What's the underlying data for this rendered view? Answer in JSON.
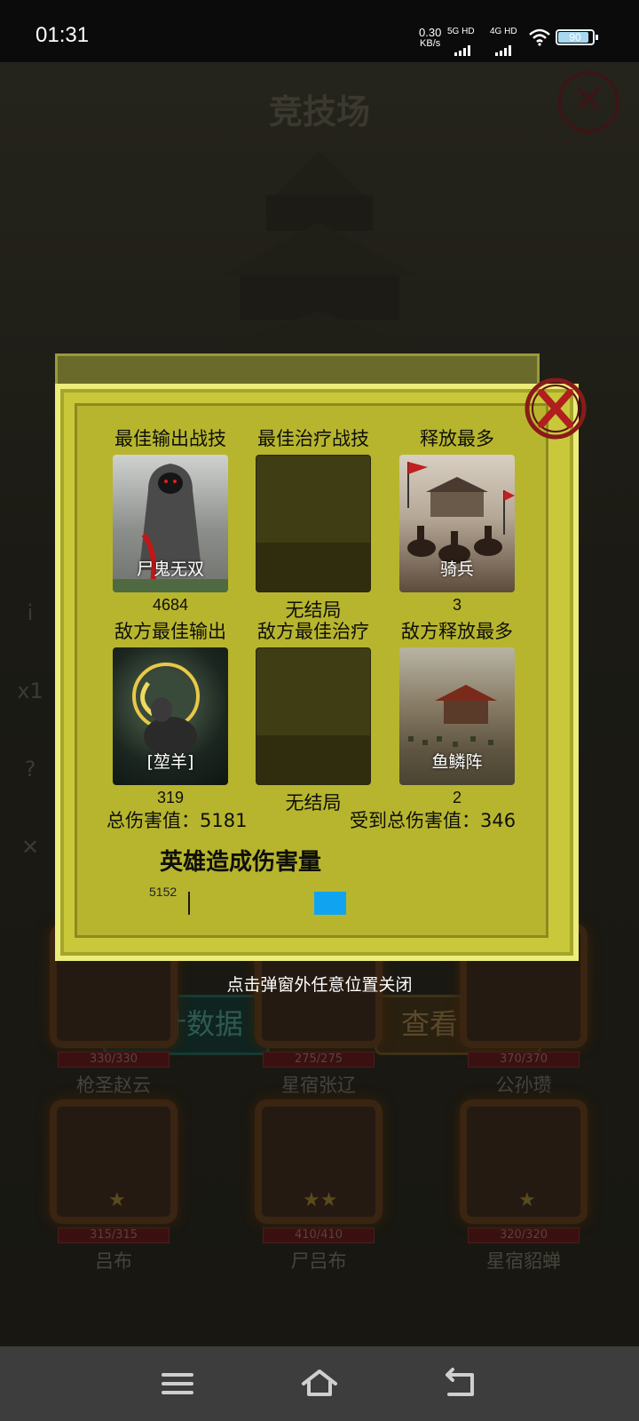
{
  "status": {
    "time": "01:31",
    "net_speed": "0.30",
    "net_unit": "KB/s",
    "sim1": "5G HD",
    "sim2": "4G HD",
    "battery": "90",
    "battery_level": 0.9
  },
  "background": {
    "title": "竞技场",
    "buttons": {
      "stats": "统计数据",
      "report": "查看战报"
    },
    "heroes": [
      {
        "hp": "330/330",
        "name": "枪圣赵云"
      },
      {
        "hp": "275/275",
        "name": "星宿张辽"
      },
      {
        "hp": "370/370",
        "name": "公孙瓒"
      },
      {
        "hp": "315/315",
        "name": "吕布"
      },
      {
        "hp": "410/410",
        "name": "尸吕布"
      },
      {
        "hp": "320/320",
        "name": "星宿貂蝉"
      }
    ],
    "side_icons": [
      "i",
      "x1",
      "?",
      "✕"
    ]
  },
  "popup": {
    "stats": [
      {
        "label": "最佳输出战技",
        "card_name": "尸鬼无双",
        "value": "4684",
        "empty": false
      },
      {
        "label": "最佳治疗战技",
        "card_name": "",
        "value": "无结局",
        "empty": true
      },
      {
        "label": "释放最多",
        "card_name": "骑兵",
        "value": "3",
        "empty": false
      },
      {
        "label": "敌方最佳输出",
        "card_name": "[堃羊]",
        "value": "319",
        "empty": false
      },
      {
        "label": "敌方最佳治疗",
        "card_name": "",
        "value": "无结局",
        "empty": true
      },
      {
        "label": "敌方释放最多",
        "card_name": "鱼鳞阵",
        "value": "2",
        "empty": false
      }
    ],
    "total_damage": "总伤害值：5181",
    "received_damage": "受到总伤害值：346",
    "chart_title": "英雄造成伤害量",
    "chart_axis_value": "5152",
    "close_hint": "点击弹窗外任意位置关闭"
  },
  "colors": {
    "popup_yellow": "#c8c83a",
    "bar_blue": "#10a4f0"
  }
}
